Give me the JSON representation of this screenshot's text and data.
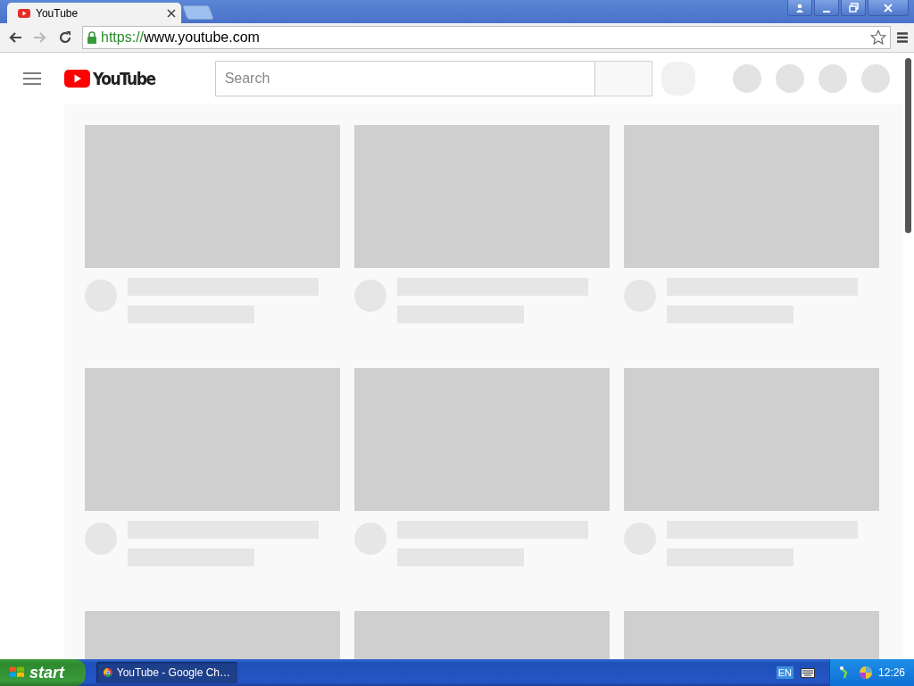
{
  "browser": {
    "tabs": [
      {
        "title": "YouTube",
        "selected": true
      }
    ],
    "nav_buttons": [
      {
        "kind": "back",
        "disabled": false
      },
      {
        "kind": "forward",
        "disabled": true
      },
      {
        "kind": "reload",
        "disabled": false
      }
    ],
    "address": {
      "scheme": "https://",
      "host": "www.youtube.com"
    }
  },
  "masthead": {
    "logo": "YouTube",
    "search": {
      "placeholder": "Search"
    }
  },
  "feed": [
    {
      "kind": "skeleton"
    },
    {
      "kind": "skeleton"
    },
    {
      "kind": "skeleton"
    },
    {
      "kind": "skeleton"
    },
    {
      "kind": "skeleton"
    },
    {
      "kind": "skeleton"
    },
    {
      "kind": "thumbnail_only"
    },
    {
      "kind": "thumbnail_only"
    },
    {
      "kind": "thumbnail_only"
    }
  ],
  "taskbar": {
    "start": "start",
    "tasks": [
      {
        "label": "YouTube - Google Ch…",
        "selected": true
      }
    ],
    "language": "EN",
    "clock": "12:26"
  }
}
